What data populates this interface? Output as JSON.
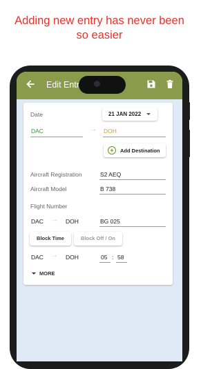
{
  "headline": {
    "line1": "Adding new entry has never been",
    "line2": "so easier"
  },
  "appbar": {
    "title": "Edit Entry",
    "color": "#8a9b4c"
  },
  "form": {
    "date_label": "Date",
    "date_value": "21 JAN 2022",
    "from": "DAC",
    "to": "DOH",
    "add_destination": "Add Destination",
    "aircraft_registration_label": "Aircraft Registration",
    "aircraft_registration_value": "S2 AEQ",
    "aircraft_model_label": "Aircraft Model",
    "aircraft_model_value": "B 738",
    "flight_number_label": "Flight Number",
    "flight_from": "DAC",
    "flight_to": "DOH",
    "flight_number_value": "BG 025",
    "block_time_button": "Block Time",
    "block_off_on_button": "Block Off / On",
    "time_from": "DAC",
    "time_to": "DOH",
    "hours": "05",
    "minutes": "58",
    "more": "MORE"
  },
  "colors": {
    "headline": "#e8312a",
    "origin": "#2f9a2f",
    "destination": "#e39a1a"
  }
}
